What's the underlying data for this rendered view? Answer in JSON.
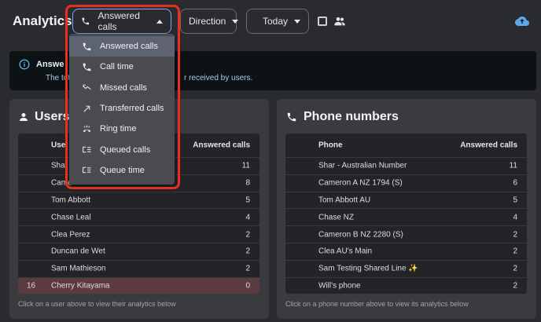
{
  "header": {
    "title": "Analytics",
    "metric_selected": "Answered calls",
    "direction_label": "Direction",
    "date_label": "Today"
  },
  "banner": {
    "title": "Answe",
    "text_left": "The total",
    "text_right": "r received by users."
  },
  "users_card": {
    "title": "Users",
    "col_user": "Use",
    "col_answered": "Answered calls",
    "rows": [
      {
        "rank": "",
        "name": "Sha",
        "value": "11"
      },
      {
        "rank": "",
        "name": "Came",
        "value": "8"
      },
      {
        "rank": "",
        "name": "Tom Abbott",
        "value": "5"
      },
      {
        "rank": "",
        "name": "Chase Leal",
        "value": "4"
      },
      {
        "rank": "",
        "name": "Clea Perez",
        "value": "2"
      },
      {
        "rank": "",
        "name": "Duncan de Wet",
        "value": "2"
      },
      {
        "rank": "",
        "name": "Sam Mathieson",
        "value": "2"
      },
      {
        "rank": "16",
        "name": "Cherry Kitayama",
        "value": "0"
      }
    ],
    "footer": "Click on a user above to view their analytics below"
  },
  "phone_card": {
    "title": "Phone numbers",
    "col_phone": "Phone",
    "col_answered": "Answered calls",
    "rows": [
      {
        "name": "Shar - Australian Number",
        "value": "11"
      },
      {
        "name": "Cameron A NZ 1794 (S)",
        "value": "6"
      },
      {
        "name": "Tom Abbott AU",
        "value": "5"
      },
      {
        "name": "Chase NZ",
        "value": "4"
      },
      {
        "name": "Cameron B NZ 2280 (S)",
        "value": "2"
      },
      {
        "name": "Clea AU's Main",
        "value": "2"
      },
      {
        "name": "Sam Testing Shared Line ✨",
        "value": "2"
      },
      {
        "name": "Will's phone",
        "value": "2"
      }
    ],
    "footer": "Click on a phone number above to view its analytics below"
  },
  "metric_menu": {
    "items": [
      {
        "label": "Answered calls",
        "icon": "phone-icon",
        "selected": true
      },
      {
        "label": "Call time",
        "icon": "phone-icon"
      },
      {
        "label": "Missed calls",
        "icon": "missed-call-icon"
      },
      {
        "label": "Transferred calls",
        "icon": "transfer-arrow-icon"
      },
      {
        "label": "Ring time",
        "icon": "ringing-phone-icon"
      },
      {
        "label": "Queued calls",
        "icon": "queue-icon"
      },
      {
        "label": "Queue time",
        "icon": "queue-icon"
      }
    ]
  },
  "colors": {
    "highlight_outline": "#e8301f",
    "highlighted_row": "#5b3a40",
    "active_border": "#7fa6ff"
  }
}
